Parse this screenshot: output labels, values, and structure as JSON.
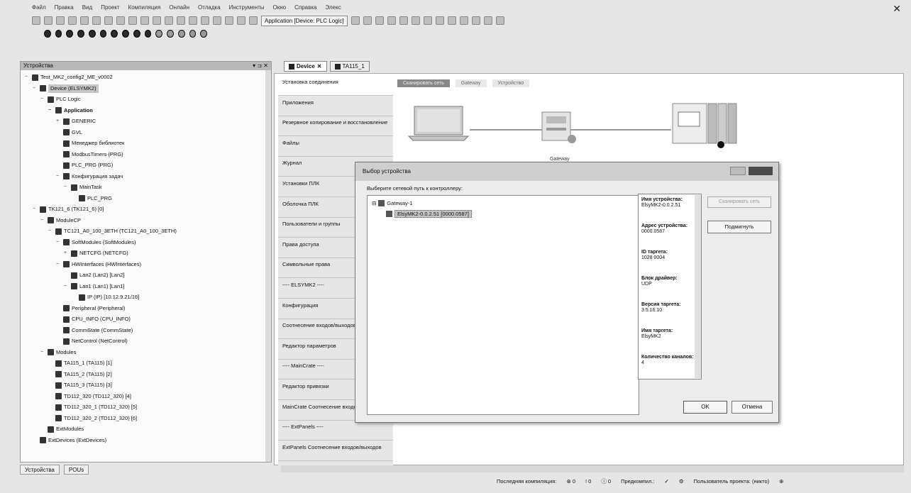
{
  "menu": [
    "Файл",
    "Правка",
    "Вид",
    "Проект",
    "Компиляция",
    "Онлайн",
    "Отладка",
    "Инструменты",
    "Окно",
    "Справка",
    "Элекс"
  ],
  "toolbar": {
    "application_combo": "Application [Device: PLC Logic]"
  },
  "left_panel": {
    "title": "Устройства",
    "tree": [
      {
        "label": "Test_MK2_config2_ME_v0002",
        "level": 0,
        "exp": "−",
        "icon": "project-icon"
      },
      {
        "label": "Device (ELSYMK2)",
        "level": 1,
        "exp": "−",
        "icon": "device-icon",
        "selected": true
      },
      {
        "label": "PLC Logic",
        "level": 2,
        "exp": "−",
        "icon": "plc-logic-icon"
      },
      {
        "label": "Application",
        "level": 3,
        "exp": "−",
        "icon": "application-icon",
        "bold": true
      },
      {
        "label": "GENERIC",
        "level": 4,
        "exp": "+",
        "icon": "folder-icon"
      },
      {
        "label": "GVL",
        "level": 4,
        "exp": "",
        "icon": "gvl-icon"
      },
      {
        "label": "Менеджер библиотек",
        "level": 4,
        "exp": "",
        "icon": "library-icon"
      },
      {
        "label": "ModbusTimers (PRG)",
        "level": 4,
        "exp": "",
        "icon": "pou-icon"
      },
      {
        "label": "PLC_PRG (PRG)",
        "level": 4,
        "exp": "",
        "icon": "pou-icon"
      },
      {
        "label": "Конфигурация задач",
        "level": 4,
        "exp": "−",
        "icon": "task-config-icon"
      },
      {
        "label": "MainTask",
        "level": 5,
        "exp": "−",
        "icon": "task-icon"
      },
      {
        "label": "PLC_PRG",
        "level": 6,
        "exp": "",
        "icon": "pou-icon"
      },
      {
        "label": "TK121_6 (TK121_6) [0]",
        "level": 1,
        "exp": "−",
        "icon": "module-icon"
      },
      {
        "label": "ModuleCP",
        "level": 2,
        "exp": "−",
        "icon": "slot-icon"
      },
      {
        "label": "TC121_A0_100_3ETH (TC121_A0_100_3ETH)",
        "level": 3,
        "exp": "−",
        "icon": "module-icon"
      },
      {
        "label": "SoftModules (SoftModules)",
        "level": 4,
        "exp": "−",
        "icon": "module-icon"
      },
      {
        "label": "NETCFG (NETCFG)",
        "level": 5,
        "exp": "+",
        "icon": "module-icon"
      },
      {
        "label": "HWInterfaces (HWInterfaces)",
        "level": 4,
        "exp": "−",
        "icon": "module-icon"
      },
      {
        "label": "Lan2 (Lan2) [Lan2]",
        "level": 5,
        "exp": "",
        "icon": "module-icon"
      },
      {
        "label": "Lan1 (Lan1) [Lan1]",
        "level": 5,
        "exp": "−",
        "icon": "module-icon"
      },
      {
        "label": "IP (IP) [10.12.9.21/16]",
        "level": 6,
        "exp": "",
        "icon": "module-icon"
      },
      {
        "label": "Peripheral (Peripheral)",
        "level": 4,
        "exp": "",
        "icon": "module-icon"
      },
      {
        "label": "CPU_INFO (CPU_INFO)",
        "level": 4,
        "exp": "",
        "icon": "module-icon"
      },
      {
        "label": "CommState (CommState)",
        "level": 4,
        "exp": "",
        "icon": "module-icon"
      },
      {
        "label": "NetControl (NetControl)",
        "level": 4,
        "exp": "",
        "icon": "module-icon"
      },
      {
        "label": "Modules",
        "level": 2,
        "exp": "−",
        "icon": "slot-icon"
      },
      {
        "label": "TA115_1 (TA115) [1]",
        "level": 3,
        "exp": "",
        "icon": "module-icon"
      },
      {
        "label": "TA115_2 (TA115) [2]",
        "level": 3,
        "exp": "",
        "icon": "module-icon"
      },
      {
        "label": "TA115_3 (TA115) [3]",
        "level": 3,
        "exp": "",
        "icon": "module-icon"
      },
      {
        "label": "TD112_320 (TD112_320) [4]",
        "level": 3,
        "exp": "",
        "icon": "module-icon"
      },
      {
        "label": "TD112_320_1 (TD112_320) [5]",
        "level": 3,
        "exp": "",
        "icon": "module-icon"
      },
      {
        "label": "TD112_320_2 (TD112_320) [6]",
        "level": 3,
        "exp": "",
        "icon": "module-icon"
      },
      {
        "label": "ExtModules",
        "level": 2,
        "exp": "",
        "icon": "slot-icon"
      },
      {
        "label": "ExtDevices (ExtDevices)",
        "level": 1,
        "exp": "",
        "icon": "module-icon"
      }
    ],
    "bottom_tabs": [
      "Устройства",
      "POUs"
    ]
  },
  "doc_tabs": [
    "Device",
    "TA115_1"
  ],
  "device_editor": {
    "nav": [
      "Установка соединения",
      "Приложения",
      "Резервное копирование и восстановление",
      "Файлы",
      "Журнал",
      "Установки ПЛК",
      "Оболочка ПЛК",
      "Пользователи и группы",
      "Права доступа",
      "Символьные права",
      "---- ELSYMK2 ----",
      "Конфигурация",
      "Соотнесение входов/выходов",
      "Редактор параметров",
      "---- MainCrate ----",
      "Редактор привязки",
      "MainCrate Соотнесение входов/выходов",
      "---- ExtPanels ----",
      "ExtPanels Соотнесение входов/выходов"
    ],
    "scan_tabs": [
      "Сканировать сеть",
      "Gateway",
      "Устройство"
    ],
    "gateway_label": "Gateway"
  },
  "dialog": {
    "title": "Выбор устройства",
    "prompt": "Выберите сетевой путь к контроллеру:",
    "gateway_node": "Gateway-1",
    "device_node": "ElsyMK2-0.0.2.51 [0000.0587]",
    "info": [
      {
        "key": "Имя устройства:",
        "value": "ElsyMK2-0.0.2.51"
      },
      {
        "key": "Адрес устройства:",
        "value": "0000.0587"
      },
      {
        "key": "ID таргета:",
        "value": "1028 0004"
      },
      {
        "key": "Блок драйвер:",
        "value": "UDP"
      },
      {
        "key": "Версия таргета:",
        "value": "3.5.16.10"
      },
      {
        "key": "Имя таргета:",
        "value": "ElsyMK2"
      },
      {
        "key": "Количество каналов:",
        "value": "4"
      }
    ],
    "scan_button": "Сканировать сеть",
    "wait_button": "Подмигнуть",
    "ok_button": "OK",
    "cancel_button": "Отмена"
  },
  "status": {
    "last_compile_label": "Последняя компиляция:",
    "errors": "0",
    "warnings": "0",
    "messages": "0",
    "precompile_label": "Предкомпил.:",
    "user_label": "Пользователь проекта: (никто)"
  }
}
